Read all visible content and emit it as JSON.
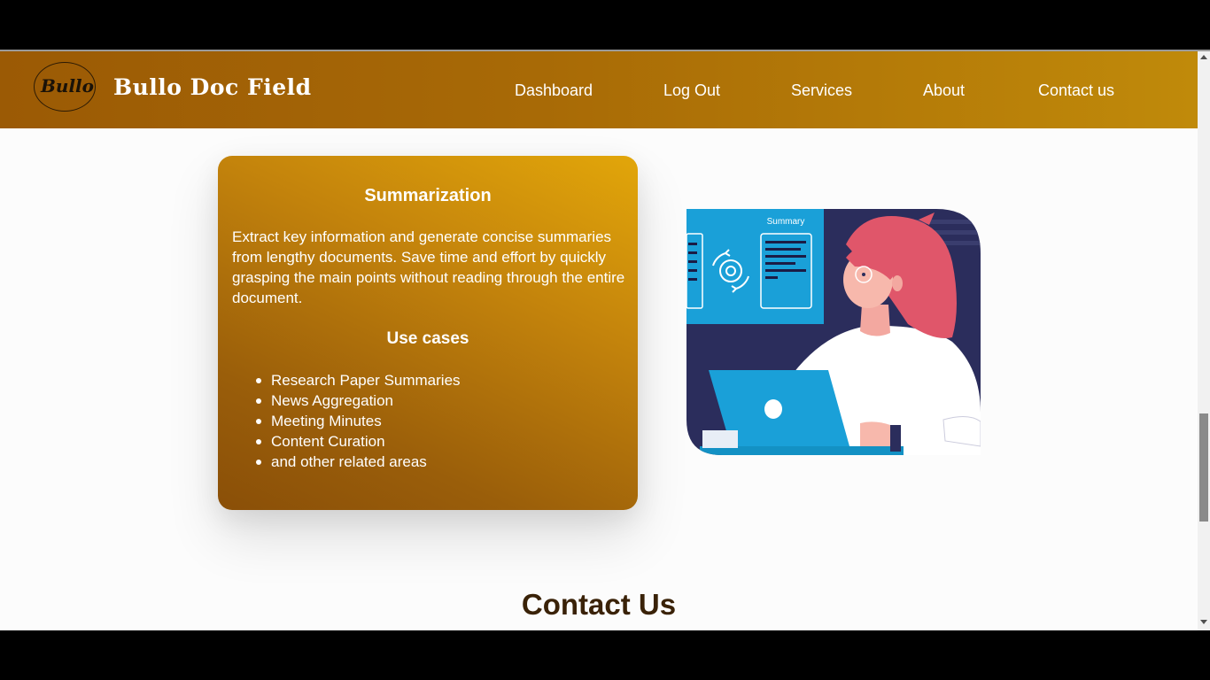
{
  "brand": {
    "logo_text": "Bullo",
    "name": "Bullo Doc Field"
  },
  "nav": {
    "dashboard": "Dashboard",
    "logout": "Log Out",
    "services": "Services",
    "about": "About",
    "contact": "Contact us"
  },
  "card": {
    "title": "Summarization",
    "description": "Extract key information and generate concise summaries from lengthy documents. Save time and effort by quickly grasping the main points without reading through the entire document.",
    "use_cases_title": "Use cases",
    "use_cases": [
      "Research Paper Summaries",
      "News Aggregation",
      "Meeting Minutes",
      "Content Curation",
      "and other related areas"
    ]
  },
  "illustration": {
    "summary_label": "Summary"
  },
  "contact": {
    "title": "Contact Us"
  },
  "colors": {
    "nav_gradient_start": "#9b5a05",
    "nav_gradient_end": "#c08a0a",
    "card_gradient_light": "#e2a60a",
    "card_gradient_dark": "#8a4f08",
    "contact_title": "#3a2208",
    "illus_navy": "#2b2d5c",
    "illus_blue": "#1aa0d8",
    "illus_hair": "#e0566a"
  }
}
